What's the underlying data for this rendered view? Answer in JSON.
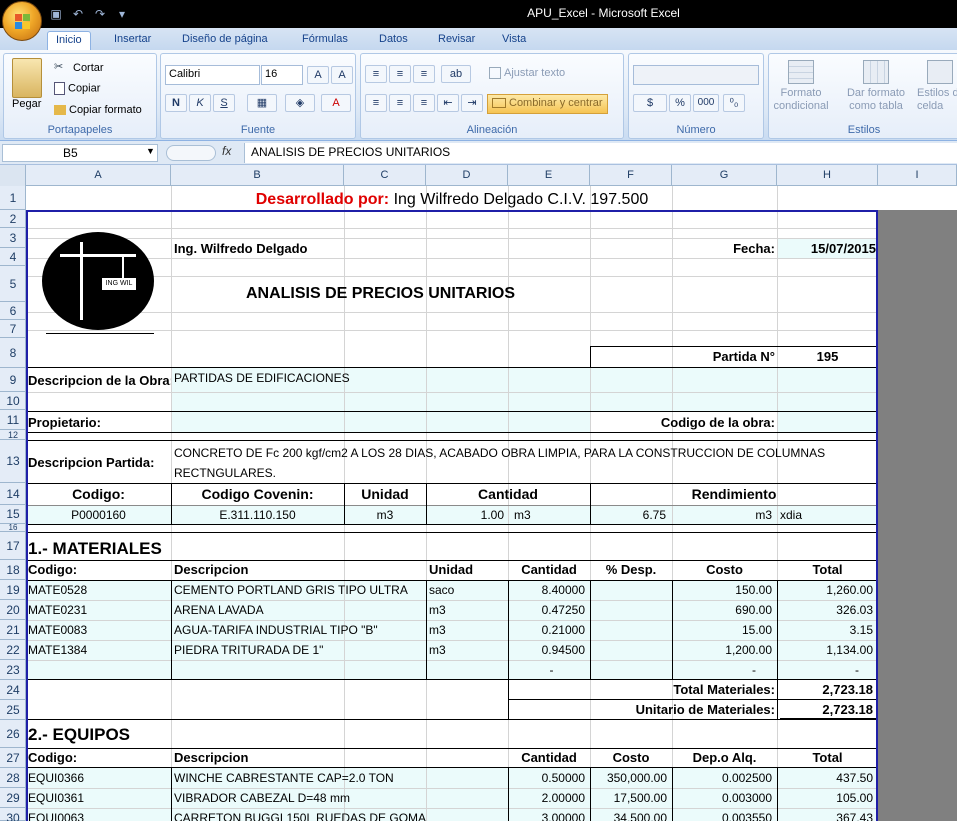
{
  "window": {
    "title": "APU_Excel - Microsoft Excel"
  },
  "tabs": [
    "Inicio",
    "Insertar",
    "Diseño de página",
    "Fórmulas",
    "Datos",
    "Revisar",
    "Vista"
  ],
  "ribbon": {
    "paste": "Pegar",
    "cut": "Cortar",
    "copy": "Copiar",
    "format_painter": "Copiar formato",
    "clipboard_label": "Portapapeles",
    "font_name": "Calibri",
    "font_size": "16",
    "font_label": "Fuente",
    "wrap_text": "Ajustar texto",
    "merge_center": "Combinar y centrar",
    "alignment_label": "Alineación",
    "number_label": "Número",
    "number_format": "",
    "cond_format_1": "Formato",
    "cond_format_2": "condicional",
    "table_format_1": "Dar formato",
    "table_format_2": "como tabla",
    "cell_styles_1": "Estilos de",
    "cell_styles_2": "celda",
    "styles_label": "Estilos",
    "bold": "N",
    "italic": "K",
    "underline": "S",
    "percent": "%",
    "thousands": "000"
  },
  "formula_bar": {
    "name_box": "B5",
    "fx": "fx",
    "value": "ANALISIS DE PRECIOS UNITARIOS"
  },
  "columns": [
    "A",
    "B",
    "C",
    "D",
    "E",
    "F",
    "G",
    "H",
    "I"
  ],
  "rows": [
    "1",
    "2",
    "3",
    "4",
    "5",
    "6",
    "7",
    "8",
    "9",
    "10",
    "11",
    "12",
    "13",
    "14",
    "15",
    "16",
    "17",
    "18",
    "19",
    "20",
    "21",
    "22",
    "23",
    "24",
    "25",
    "26",
    "27",
    "28",
    "29",
    "30"
  ],
  "sheet": {
    "dev_label": "Desarrollado por:",
    "dev_name": "Ing Wilfredo Delgado C.I.V. 197.500",
    "logo_text": "ING WIL",
    "engineer": "Ing. Wilfredo Delgado",
    "fecha_label": "Fecha:",
    "fecha": "15/07/2015",
    "title": "ANALISIS DE PRECIOS UNITARIOS",
    "partida_label": "Partida N°",
    "partida": "195",
    "obra_label": "Descripcion de la Obra:",
    "obra": "PARTIDAS DE EDIFICACIONES",
    "propietario_label": "Propietario:",
    "codigo_obra_label": "Codigo de la obra:",
    "desc_partida_label": "Descripcion Partida:",
    "desc_partida_1": "CONCRETO DE Fc 200 kgf/cm2 A LOS 28 DIAS, ACABADO OBRA LIMPIA, PARA LA CONSTRUCCION DE COLUMNAS",
    "desc_partida_2": "RECTNGULARES.",
    "h_codigo": "Codigo:",
    "h_covenin": "Codigo Covenin:",
    "h_unidad": "Unidad",
    "h_cantidad": "Cantidad",
    "h_rendimiento": "Rendimiento",
    "codigo": "P0000160",
    "covenin": "E.311.110.150",
    "unidad": "m3",
    "cantidad": "1.00",
    "cantidad_unit": "m3",
    "rendimiento": "6.75",
    "rend_unit": "m3",
    "rend_per": "xdia",
    "mat_section": "1.- MATERIALES",
    "mat_headers": {
      "codigo": "Codigo:",
      "desc": "Descripcion",
      "unidad": "Unidad",
      "cantidad": "Cantidad",
      "desp": "% Desp.",
      "costo": "Costo",
      "total": "Total"
    },
    "materials": [
      {
        "codigo": "MATE0528",
        "desc": "CEMENTO PORTLAND GRIS TIPO ULTRA",
        "unidad": "saco",
        "cantidad": "8.40000",
        "costo": "150.00",
        "total": "1,260.00"
      },
      {
        "codigo": "MATE0231",
        "desc": "ARENA LAVADA",
        "unidad": "m3",
        "cantidad": "0.47250",
        "costo": "690.00",
        "total": "326.03"
      },
      {
        "codigo": "MATE0083",
        "desc": "AGUA-TARIFA INDUSTRIAL TIPO \"B\"",
        "unidad": "m3",
        "cantidad": "0.21000",
        "costo": "15.00",
        "total": "3.15"
      },
      {
        "codigo": "MATE1384",
        "desc": "PIEDRA TRITURADA DE 1\"",
        "unidad": "m3",
        "cantidad": "0.94500",
        "costo": "1,200.00",
        "total": "1,134.00"
      },
      {
        "codigo": "",
        "desc": "",
        "unidad": "",
        "cantidad": "-",
        "costo": "-",
        "total": "-"
      }
    ],
    "total_mat_label": "Total Materiales:",
    "total_mat": "2,723.18",
    "unit_mat_label": "Unitario de Materiales:",
    "unit_mat": "2,723.18",
    "eq_section": "2.- EQUIPOS",
    "eq_headers": {
      "codigo": "Codigo:",
      "desc": "Descripcion",
      "cantidad": "Cantidad",
      "costo": "Costo",
      "dep": "Dep.o Alq.",
      "total": "Total"
    },
    "equipment": [
      {
        "codigo": "EQUI0366",
        "desc": "WINCHE CABRESTANTE CAP=2.0 TON",
        "cantidad": "0.50000",
        "costo": "350,000.00",
        "dep": "0.002500",
        "total": "437.50"
      },
      {
        "codigo": "EQUI0361",
        "desc": "VIBRADOR CABEZAL D=48 mm",
        "cantidad": "2.00000",
        "costo": "17,500.00",
        "dep": "0.003000",
        "total": "105.00"
      },
      {
        "codigo": "EQUI0063",
        "desc": "CARRETON BUGGI 150L RUEDAS DE GOMA",
        "cantidad": "3.00000",
        "costo": "34,500.00",
        "dep": "0.003550",
        "total": "367.43"
      }
    ]
  }
}
